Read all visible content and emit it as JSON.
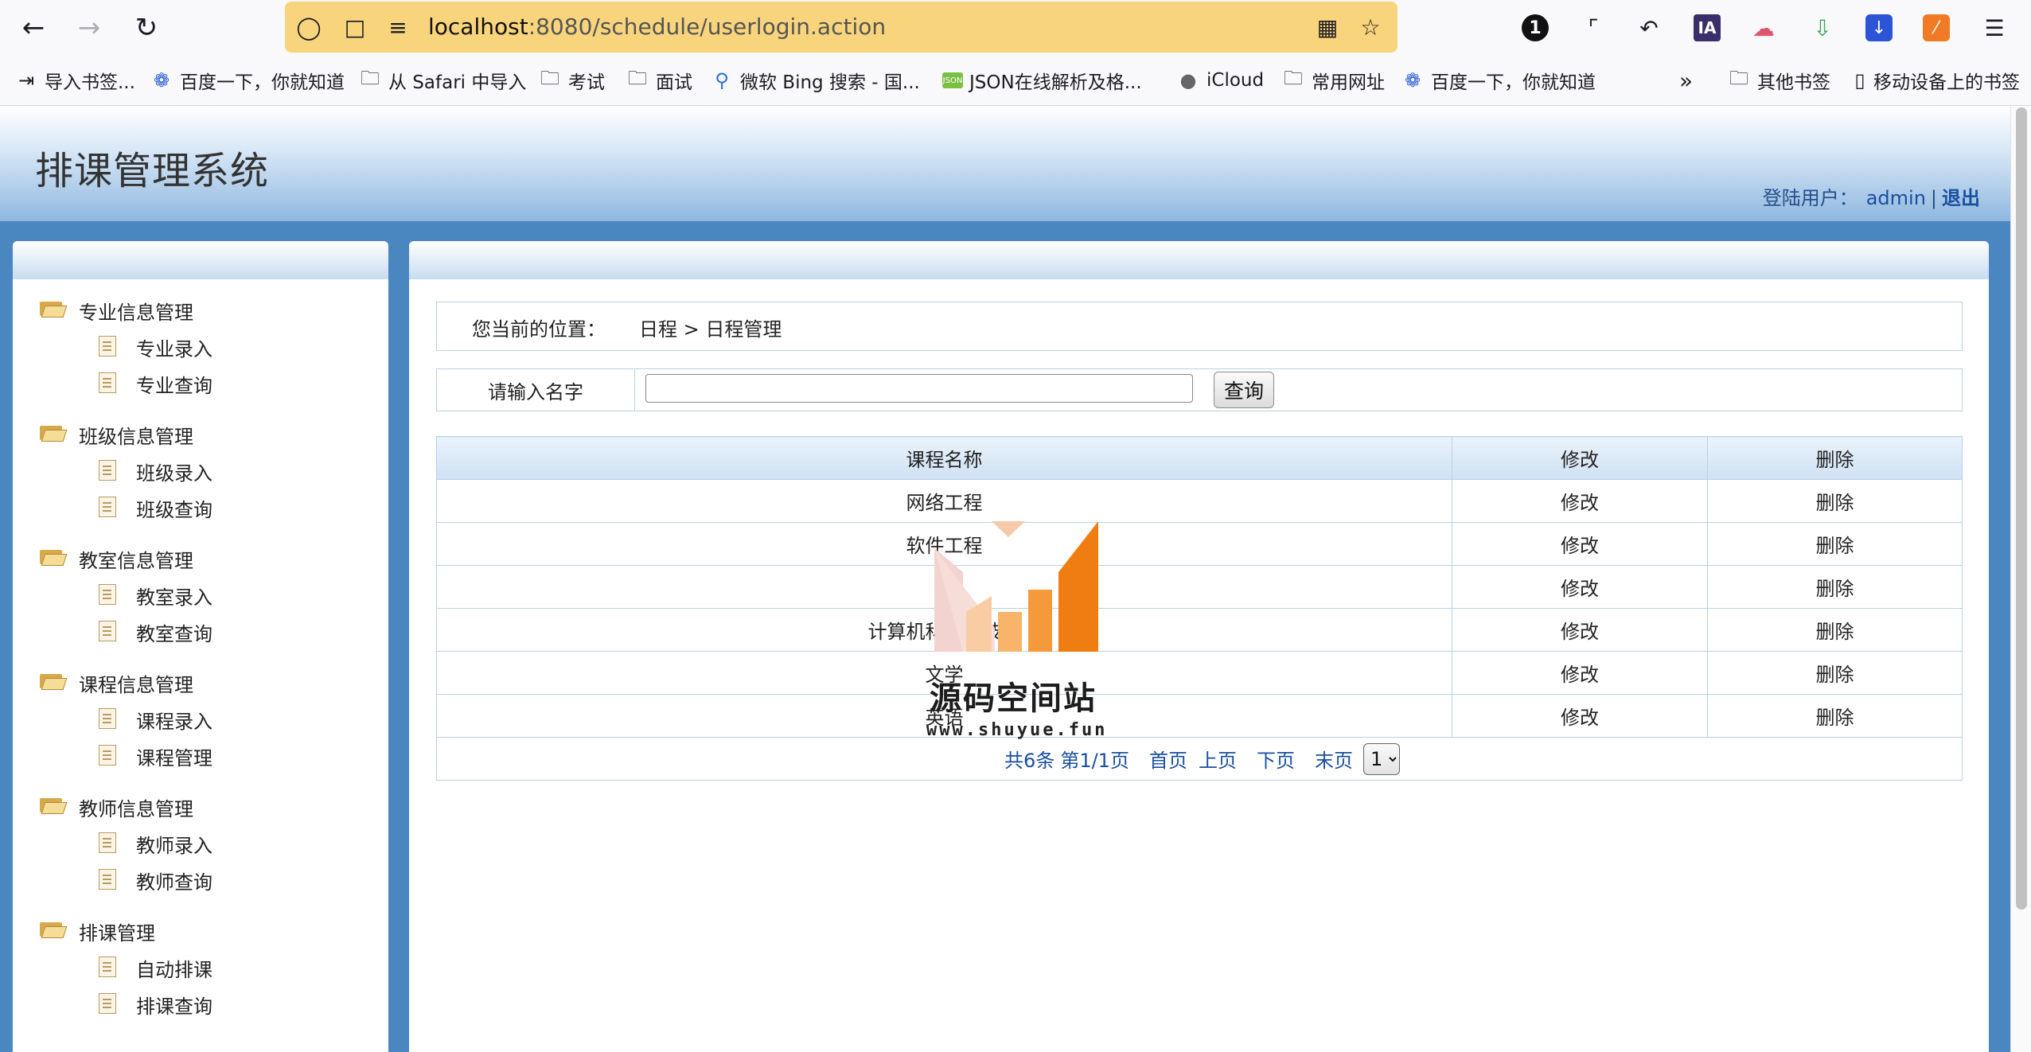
{
  "browser": {
    "url_host": "localhost",
    "url_rest": ":8080/schedule/userlogin.action",
    "bookmarks": [
      "导入书签...",
      "百度一下，你就知道",
      "从 Safari 中导入",
      "考试",
      "面试",
      "微软 Bing 搜索 - 国...",
      "JSON在线解析及格...",
      "iCloud",
      "常用网址",
      "百度一下，你就知道"
    ],
    "other_bookmarks": "其他书签",
    "mobile_bookmarks": "移动设备上的书签",
    "ext_onepassword": "1",
    "ext_ia": "IA"
  },
  "app": {
    "title": "排课管理系统",
    "user_label": "登陆用户：",
    "username": "admin",
    "separator": "|",
    "logout": "退出"
  },
  "sidebar": {
    "groups": [
      {
        "label": "专业信息管理",
        "items": [
          "专业录入",
          "专业查询"
        ]
      },
      {
        "label": "班级信息管理",
        "items": [
          "班级录入",
          "班级查询"
        ]
      },
      {
        "label": "教室信息管理",
        "items": [
          "教室录入",
          "教室查询"
        ]
      },
      {
        "label": "课程信息管理",
        "items": [
          "课程录入",
          "课程管理"
        ]
      },
      {
        "label": "教师信息管理",
        "items": [
          "教师录入",
          "教师查询"
        ]
      },
      {
        "label": "排课管理",
        "items": [
          "自动排课",
          "排课查询"
        ]
      }
    ]
  },
  "main": {
    "breadcrumb_label": "您当前的位置：",
    "breadcrumb_path": "日程 > 日程管理",
    "search_label": "请输入名字",
    "search_value": "",
    "search_button": "查询",
    "table": {
      "headers": [
        "课程名称",
        "修改",
        "删除"
      ],
      "rows": [
        [
          "网络工程",
          "修改",
          "删除"
        ],
        [
          "软件工程",
          "修改",
          "删除"
        ],
        [
          "",
          "修改",
          "删除"
        ],
        [
          "计算机科学与技术",
          "修改",
          "删除"
        ],
        [
          "文学",
          "修改",
          "删除"
        ],
        [
          "英语",
          "修改",
          "删除"
        ]
      ]
    },
    "pager": {
      "total": "共6条",
      "page_info": "第1/1页",
      "first": "首页",
      "prev": "上页",
      "next": "下页",
      "last": "末页",
      "selected_page": "1"
    }
  },
  "watermark": {
    "text": "源码空间站",
    "url": "www.shuyue.fun"
  },
  "colors": {
    "page_bg": "#4a86c0",
    "header_gradient_end": "#8fb8df",
    "link": "#1a4fa0",
    "table_border": "#b9d1ea",
    "url_bar": "#f8d57c"
  }
}
